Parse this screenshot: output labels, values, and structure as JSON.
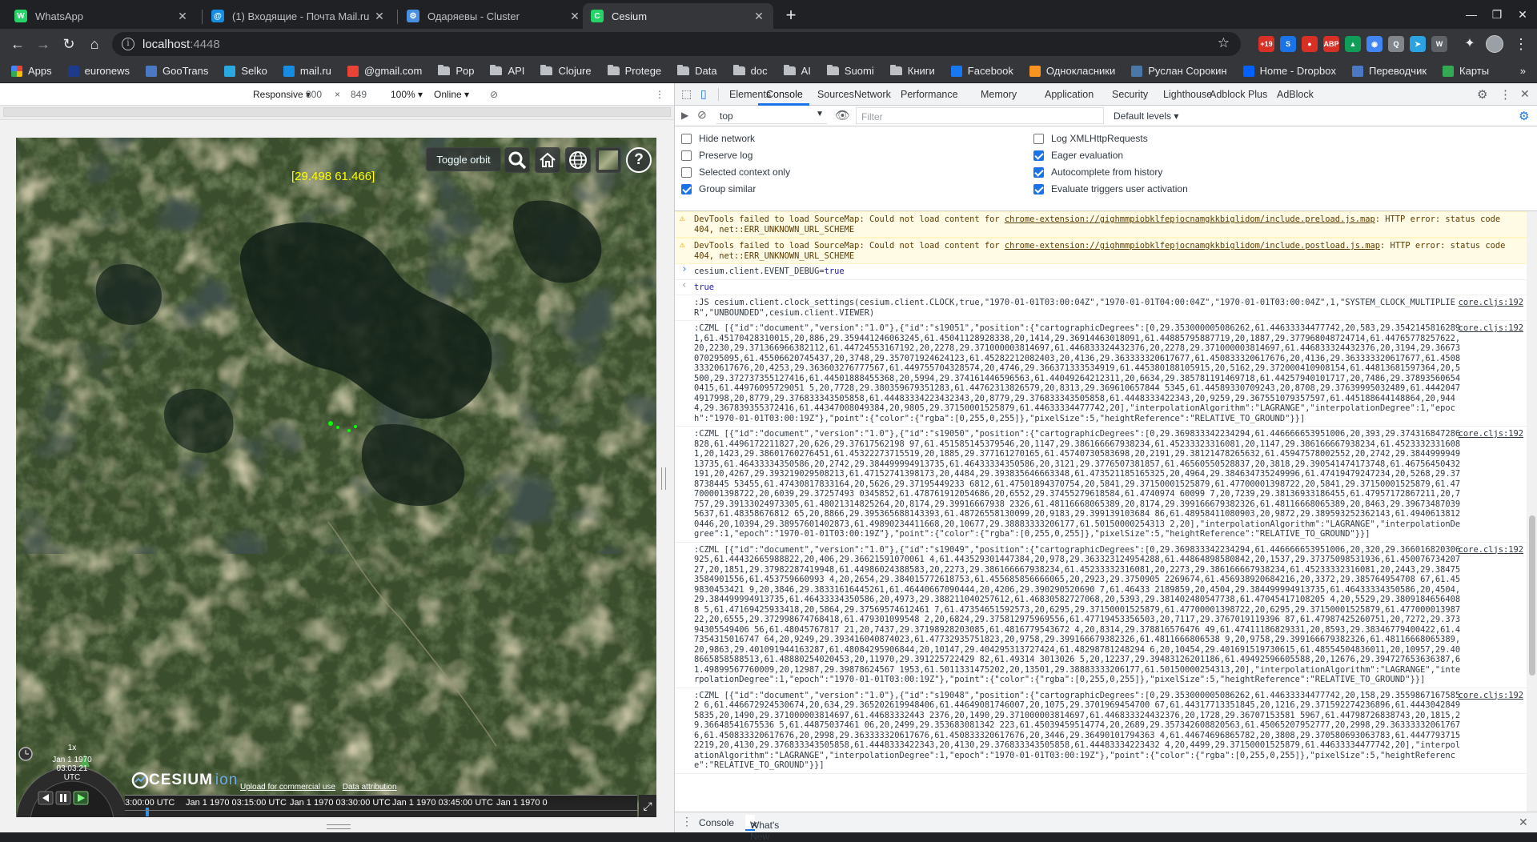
{
  "tabs": [
    {
      "title": "WhatsApp",
      "color": "#25d366",
      "glyph": "W",
      "active": false
    },
    {
      "title": "(1) Входящие - Почта Mail.ru",
      "color": "#168de2",
      "glyph": "@",
      "active": false
    },
    {
      "title": "Одаряевы - Cluster",
      "color": "#4a90e2",
      "glyph": "⚙",
      "active": false
    },
    {
      "title": "Cesium",
      "color": "#25d366",
      "glyph": "C",
      "active": true
    }
  ],
  "address": {
    "host": "localhost",
    "port": ":4448"
  },
  "extensions": [
    {
      "name": "extension-badge-19",
      "label": "+19",
      "color": "#d93025"
    },
    {
      "name": "extension-s",
      "label": "S",
      "color": "#1a73e8"
    },
    {
      "name": "extension-red",
      "label": "●",
      "color": "#d93025"
    },
    {
      "name": "adblock-plus",
      "label": "ABP",
      "color": "#d93025"
    },
    {
      "name": "google-drive",
      "label": "▲",
      "color": "#0f9d58"
    },
    {
      "name": "extension-chrome",
      "label": "◉",
      "color": "#4285f4"
    },
    {
      "name": "extension-q",
      "label": "Q",
      "color": "#80868b"
    },
    {
      "name": "telegram",
      "label": "➤",
      "color": "#2aa3e0"
    },
    {
      "name": "extension-w",
      "label": "W",
      "color": "#5f6368"
    }
  ],
  "bookmarks": [
    {
      "label": "Apps",
      "icon": "grid",
      "color": "#ea4335"
    },
    {
      "label": "euronews",
      "icon": "square",
      "color": "#1e3a8a"
    },
    {
      "label": "GooTrans",
      "icon": "square",
      "color": "#4a78c2"
    },
    {
      "label": "Selko",
      "icon": "square",
      "color": "#2aa9e0"
    },
    {
      "label": "mail.ru",
      "icon": "square",
      "color": "#168de2"
    },
    {
      "label": "@gmail.com",
      "icon": "square",
      "color": "#ea4335"
    },
    {
      "label": "Pop",
      "icon": "folder"
    },
    {
      "label": "API",
      "icon": "folder"
    },
    {
      "label": "Clojure",
      "icon": "folder"
    },
    {
      "label": "Protege",
      "icon": "folder"
    },
    {
      "label": "Data",
      "icon": "folder"
    },
    {
      "label": "doc",
      "icon": "folder"
    },
    {
      "label": "AI",
      "icon": "folder"
    },
    {
      "label": "Suomi",
      "icon": "folder"
    },
    {
      "label": "Книги",
      "icon": "folder"
    },
    {
      "label": "Facebook",
      "icon": "square",
      "color": "#1877f2"
    },
    {
      "label": "Однокласники",
      "icon": "square",
      "color": "#f7931e"
    },
    {
      "label": "Руслан Сорокин",
      "icon": "square",
      "color": "#4a76a8"
    },
    {
      "label": "Home - Dropbox",
      "icon": "square",
      "color": "#0061fe"
    },
    {
      "label": "Переводчик",
      "icon": "square",
      "color": "#4a78c2"
    },
    {
      "label": "Карты",
      "icon": "square",
      "color": "#34a853"
    }
  ],
  "device_toolbar": {
    "mode": "Responsive ▾",
    "width": "800",
    "times": "×",
    "height": "849",
    "zoom": "100% ▾",
    "network": "Online ▾"
  },
  "cesium": {
    "coordinate": "[29.498 61.466]",
    "toggle_orbit": "Toggle orbit",
    "speed": "1x",
    "date": "Jan 1 1970",
    "time": "03:03:21 UTC",
    "logo": "CESIUM",
    "logo_ion": "ion",
    "credit_1": "Upload for commercial use",
    "credit_2": "Data attribution",
    "timeline_labels": [
      "3:00:00 UTC",
      "Jan 1 1970 03:15:00 UTC",
      "Jan 1 1970 03:30:00 UTC",
      "Jan 1 1970 03:45:00 UTC",
      "Jan 1 1970 0"
    ]
  },
  "devtools": {
    "tabs": [
      "Elements",
      "Console",
      "Sources",
      "Network",
      "Performance",
      "Memory",
      "Application",
      "Security",
      "Lighthouse",
      "Adblock Plus",
      "AdBlock"
    ],
    "active_tab": "Console",
    "context": "top",
    "filter_placeholder": "Filter",
    "levels": "Default levels ▾",
    "options_left": [
      {
        "label": "Hide network",
        "checked": false
      },
      {
        "label": "Preserve log",
        "checked": false
      },
      {
        "label": "Selected context only",
        "checked": false
      },
      {
        "label": "Group similar",
        "checked": true
      }
    ],
    "options_right": [
      {
        "label": "Log XMLHttpRequests",
        "checked": false
      },
      {
        "label": "Eager evaluation",
        "checked": true
      },
      {
        "label": "Autocomplete from history",
        "checked": true
      },
      {
        "label": "Evaluate triggers user activation",
        "checked": true
      }
    ],
    "warnings": [
      {
        "prefix": "DevTools failed to load SourceMap: Could not load content for ",
        "link": "chrome-extension://gighmmpiobklfepjocnamgkkbiglidom/include.preload.js.map",
        "suffix": ": HTTP error: status code 404, net::ERR_UNKNOWN_URL_SCHEME"
      },
      {
        "prefix": "DevTools failed to load SourceMap: Could not load content for ",
        "link": "chrome-extension://gighmmpiobklfepjocnamgkkbiglidom/include.postload.js.map",
        "suffix": ": HTTP error: status code 404, net::ERR_UNKNOWN_URL_SCHEME"
      }
    ],
    "input_line": {
      "code": "cesium.client.EVENT_DEBUG=",
      "value": "true"
    },
    "output_line": "true",
    "logs": [
      {
        "text": ":JS cesium.client.clock_settings(cesium.client.CLOCK,true,\"1970-01-01T03:00:04Z\",\"1970-01-01T04:00:04Z\",\"1970-01-01T03:00:04Z\",1,\"SYSTEM_CLOCK_MULTIPLIER\",\"UNBOUNDED\",cesium.client.VIEWER)",
        "source": "core.cljs:192"
      },
      {
        "text": ":CZML [{\"id\":\"document\",\"version\":\"1.0\"},{\"id\":\"s19051\",\"position\":{\"cartographicDegrees\":[0,29.353000005086262,61.44633334477742,20,583,29.35421458162891,61.45170428310015,20,886,29.359441246063245,61.45041128928338,20,1414,29.36914463018091,61.44885795887719,20,1887,29.377968048724714,61.44765778257622,20,2230,29.371366966382112,61.44724553167192,20,2278,29.371000003814697,61.446833324432376,20,2278,29.371000003814697,61.446833324432376,20,3194,29.36673070295095,61.45506620745437,20,3748,29.357071924624123,61.45282212082403,20,4136,29.363333320617677,61.450833320617676,20,4136,29.363333320617677,61.450833320617676,20,4253,29.363603276777567,61.449755704328574,20,4746,29.366371333534919,61.445380188105915,20,5162,29.372000410908154,61.44813681597364,20,5500,29.372737355127416,61.44501888455368,20,5994,29.374161446596563,61.44049264212311,20,6634,29.385781191469718,61.44257940101717,20,7486,29.378935606540415,61.44976095729051 5,20,7728,29.380359679351283,61.44762313826579,20,8313,29.369610657844 5345,61.44589330709243,20,8708,29.37639995032489,61.44420474917998,20,8779,29.376833343505858,61.44483334223432343,20,8779,29.376833343505858,61.4448333422343,20,9259,29.367551079357597,61.445188644148864,20,9444,29.367839355372416,61.44347008049384,20,9805,29.37150001525879,61.44633334477742,20],\"interpolationAlgorithm\":\"LAGRANGE\",\"interpolationDegree\":1,\"epoch\":\"1970-01-01T03:00:19Z\"},\"point\":{\"color\":{\"rgba\":[0,255,0,255]},\"pixelSize\":5,\"heightReference\":\"RELATIVE_TO_GROUND\"}}]",
        "source": "core.cljs:192"
      },
      {
        "text": ":CZML [{\"id\":\"document\",\"version\":\"1.0\"},{\"id\":\"s19050\",\"position\":{\"cartographicDegrees\":[0,29.369833342234294,61.446666653951006,20,393,29.374316847286828,61.4496172211827,20,626,29.37617562198 97,61.451585145379546,20,1147,29.386166667938234,61.45233323316081,20,1147,29.386166667938234,61.45233323316081,20,1423,29.38601760276451,61.45322273715519,20,1885,29.377161270165,61.45740730583698,20,2191,29.38121478265632,61.45947578002552,20,2742,29.384499994913735,61.46433334350586,20,2742,29.384499994913735,61.46433334350586,20,3121,29.3776507381857,61.46560550528837,20,3818,29.390541474173748,61.46756450432191,20,4267,29.393219029508213,61.47152741398173,20,4484,29.393835646663348,61.473521185165325,20,4964,29.384634735249996,61.47419479247234,20,5268,29.378738445 53455,61.47430817833164,20,5626,29.37195449233 6812,61.47501894370754,20,5841,29.37150001525879,61.47700001398722,20,5841,29.37150001525879,61.47700001398722,20,6039,29.37257493 0345852,61.478761912054686,20,6552,29.37455279618584,61.4740974 60099 7,20,7239,29.38136933186455,61.47957172867211,20,7757,29.39133024973305,61.48021314825264,20,8174,29.39916667938 2326,61.48116668065389,20,8174,29.399166679382326,61.48116668065389,20,8463,29.396734870395637,61.48358676812 65,20,8866,29.395365688143393,61.48726558130099,20,9183,29.399139103684 86,61.48958411080903,20,9872,29.389593252362143,61.49406138120446,20,10394,29.38957601402873,61.49890234411668,20,10677,29.38883333206177,61.50150000254313 2,20],\"interpolationAlgorithm\":\"LAGRANGE\",\"interpolationDegree\":1,\"epoch\":\"1970-01-01T03:00:19Z\"},\"point\":{\"color\":{\"rgba\":[0,255,0,255]},\"pixelSize\":5,\"heightReference\":\"RELATIVE_TO_GROUND\"}}]",
        "source": "core.cljs:192"
      },
      {
        "text": ":CZML [{\"id\":\"document\",\"version\":\"1.0\"},{\"id\":\"s19049\",\"position\":{\"cartographicDegrees\":[0,29.369833342234294,61.446666653951006,20,320,29.366016820306925,61.44432665988822,20,406,29.36621591070061 4,61.443529301447384,20,978,29.363323124954288,61.44864898580842,20,1537,29.37375098531936,61.45007673420727,20,1851,29.37982287419948,61.44986024388583,20,2273,29.386166667938234,61.45233332316081,20,2273,29.386166667938234,61.45233332316081,20,2443,29.384753584901556,61.453759660993 4,20,2654,29.384015772618753,61.455685856666065,20,2923,29.3750905 2269674,61.456938920684216,20,3372,29.385764954708 67,61.459830453421 9,20,3846,29.38331616445261,61.46440667090444,20,4206,29.390290520690 7,61.46433 2189859,20,4504,29.384499994913735,61.46433334350586,20,4504,29.384499994913735,61.46433334350586,20,4973,29.388211040257612,61.46830582727068,20,5393,29.381402480547738,61.47045417108205 4,20,5529,29.38091846564088 5,61.47169425933418,20,5864,29.37569574612461 7,61.47354651592573,20,6295,29.37150001525879,61.47700001398722,20,6295,29.37150001525879,61.47700001398722,20,6555,29.372998674768418,61.479301099548 2,20,6824,29.375812975969556,61.47719453356503,20,7117,29.3767019119396 87,61.47987425260751,20,7272,29.37394305549406 56,61.48045767817 21,20,7437,29.37198928203085,61.4816779543672 4,20,8314,29.378816576476 49,61.47411186829331,20,8593,29.38346779400422,61.47354315016747 64,20,9249,29.393416040874023,61.47732935751823,20,9758,29.399166679382326,61.4811666806538 9,20,9758,29.399166679382326,61.48116668065389,20,9863,29.401091944163287,61.48084295906844,20,10147,29.404295313727424,61.48298781248294 6,20,10454,29.401691519730615,61.48554504836011,20,10957,29.408665858588513,61.48880254020453,20,11970,29.391225722429 82,61.49314 3013026 5,20,12237,29.39483126201186,61.49492596605588,20,12676,29.394727653636387,61.49899567760009,20,12987,29.39878624567 1953,61.5011331475202,20,13501,29.38883333206177,61.50150000254313,20],\"interpolationAlgorithm\":\"LAGRANGE\",\"interpolationDegree\":1,\"epoch\":\"1970-01-01T03:00:19Z\"},\"point\":{\"color\":{\"rgba\":[0,255,0,255]},\"pixelSize\":5,\"heightReference\":\"RELATIVE_TO_GROUND\"}}]",
        "source": "core.cljs:192"
      },
      {
        "text": ":CZML [{\"id\":\"document\",\"version\":\"1.0\"},{\"id\":\"s19048\",\"position\":{\"cartographicDegrees\":[0,29.353000005086262,61.44633334477742,20,158,29.35598671675852 6,61.446672924530674,20,634,29.365202619948406,61.44649081746007,20,1075,29.3701969454700 67,61.44317713351845,20,1216,29.371592274236896,61.44430428495835,20,1490,29.371000003814697,61.44683332443 2376,20,1490,29.371000003814697,61.446833324432376,20,1728,29.36707153581 5967,61.44798726838743,20,1815,29.36648541675536 5,61.44875037461 06,20,2499,29.353683081342 223,61.45039459514774,20,2689,29.357342608820563,61.45065207952777,20,2998,29.363333320617676,61.450833320617676,20,2998,29.363333320617676,61.450833320617676,20,3446,29.36490101794363 4,61.44674696865782,20,3808,29.370580693063783,61.44477937152219,20,4130,29.376833343505858,61.4448333422343,20,4130,29.376833343505858,61.44483334223432 4,20,4499,29.37150001525879,61.44633334477742,20],\"interpolationAlgorithm\":\"LAGRANGE\",\"interpolationDegree\":1,\"epoch\":\"1970-01-01T03:00:19Z\"},\"point\":{\"color\":{\"rgba\":[0,255,0,255]},\"pixelSize\":5,\"heightReference\":\"RELATIVE_TO_GROUND\"}}]",
        "source": "core.cljs:192"
      }
    ],
    "drawer_tabs": [
      "Console",
      "What's New"
    ]
  }
}
